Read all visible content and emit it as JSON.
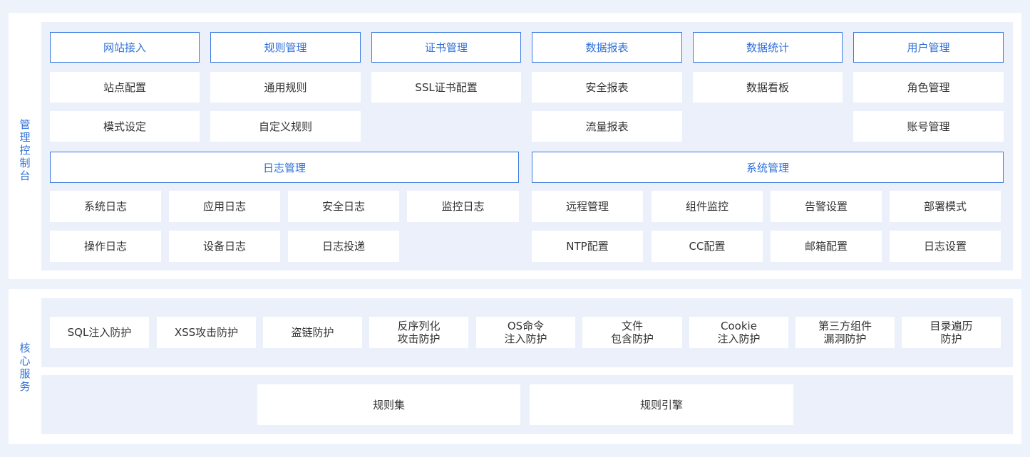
{
  "console": {
    "label": "管理控制台",
    "headers": [
      "网站接入",
      "规则管理",
      "证书管理",
      "数据报表",
      "数据统计",
      "用户管理"
    ],
    "row1": [
      "站点配置",
      "通用规则",
      "SSL证书配置",
      "安全报表",
      "数据看板",
      "角色管理"
    ],
    "row2": [
      "模式设定",
      "自定义规则",
      "流量报表",
      "账号管理"
    ],
    "log_header": "日志管理",
    "sys_header": "系统管理",
    "log_row1": [
      "系统日志",
      "应用日志",
      "安全日志",
      "监控日志"
    ],
    "log_row2": [
      "操作日志",
      "设备日志",
      "日志投递"
    ],
    "sys_row1": [
      "远程管理",
      "组件监控",
      "告警设置",
      "部署模式"
    ],
    "sys_row2": [
      "NTP配置",
      "CC配置",
      "邮箱配置",
      "日志设置"
    ]
  },
  "core": {
    "label": "核心服务",
    "protections": [
      "SQL注入防护",
      "XSS攻击防护",
      "盗链防护",
      "反序列化\n攻击防护",
      "OS命令\n注入防护",
      "文件\n包含防护",
      "Cookie\n注入防护",
      "第三方组件\n漏洞防护",
      "目录遍历\n防护"
    ],
    "engine": [
      "规则集",
      "规则引擎"
    ]
  }
}
